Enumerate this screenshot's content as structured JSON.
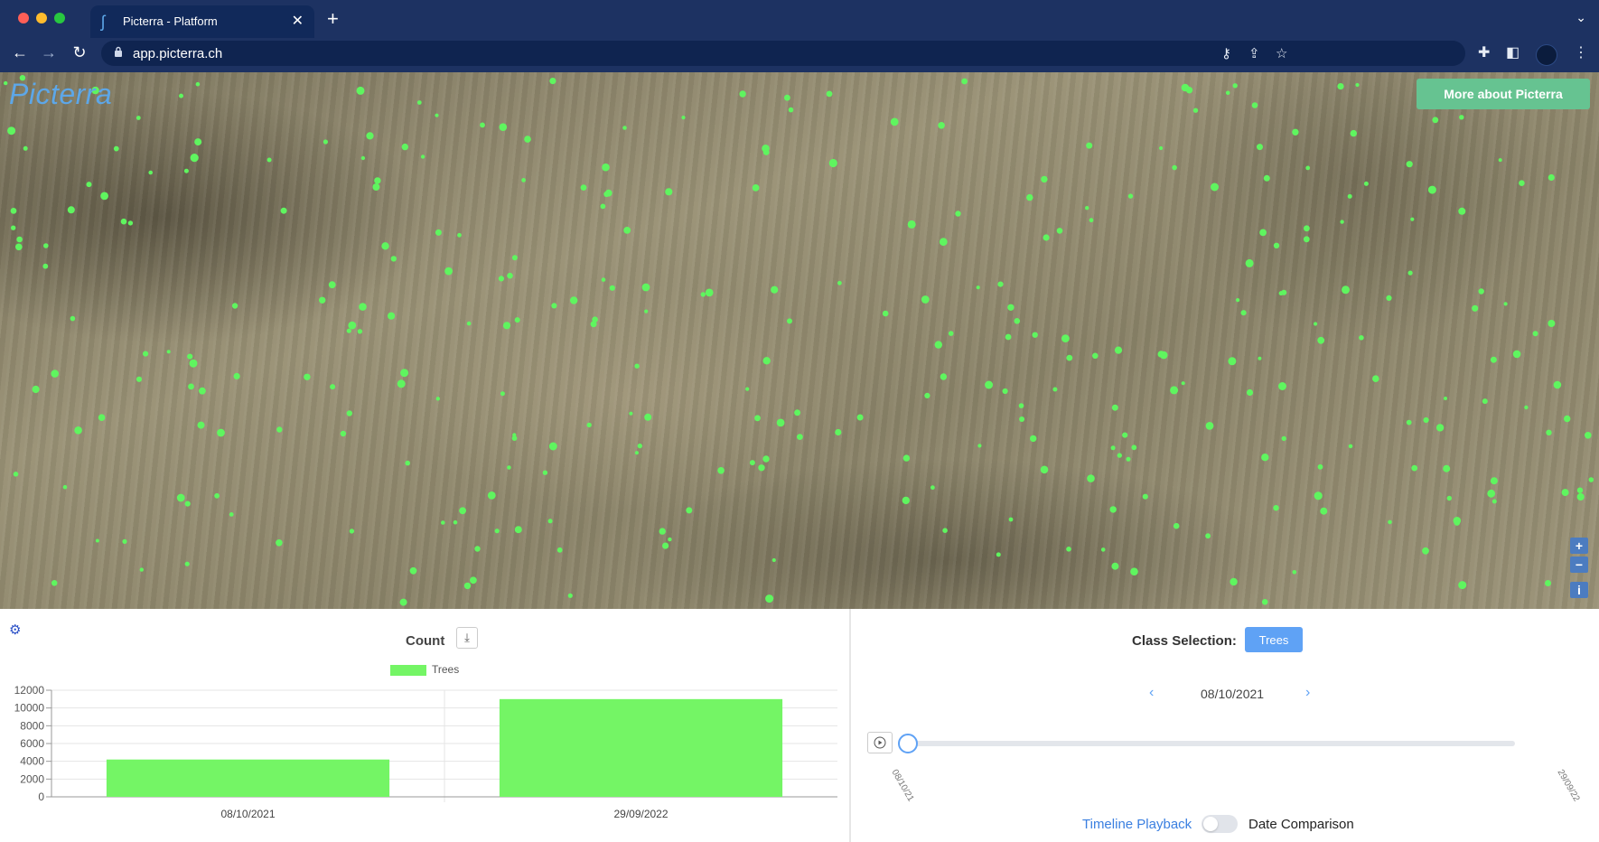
{
  "browser": {
    "tab_title": "Picterra - Platform",
    "url": "app.picterra.ch",
    "tab_close": "✕",
    "new_tab": "+",
    "tab_menu": "⌄"
  },
  "map": {
    "logo_text": "Picterra",
    "more_button": "More about Picterra",
    "zoom_in": "+",
    "zoom_out": "−",
    "info": "i",
    "detection_color": "#5ff55f"
  },
  "chart_panel": {
    "title": "Count",
    "legend": "Trees"
  },
  "chart_data": {
    "type": "bar",
    "categories": [
      "08/10/2021",
      "29/09/2022"
    ],
    "series": [
      {
        "name": "Trees",
        "values": [
          4200,
          11000
        ],
        "color": "#74f565"
      }
    ],
    "ylim": [
      0,
      12000
    ],
    "yticks": [
      0,
      2000,
      4000,
      6000,
      8000,
      10000,
      12000
    ],
    "grid": true,
    "legend_position": "top"
  },
  "timeline_panel": {
    "class_label": "Class Selection:",
    "class_button": "Trees",
    "current_date": "08/10/2021",
    "start_tick": "08/10/21",
    "end_tick": "29/09/22",
    "playback_label": "Timeline Playback",
    "comparison_label": "Date Comparison",
    "slider_position": 0,
    "toggle_on": false
  }
}
